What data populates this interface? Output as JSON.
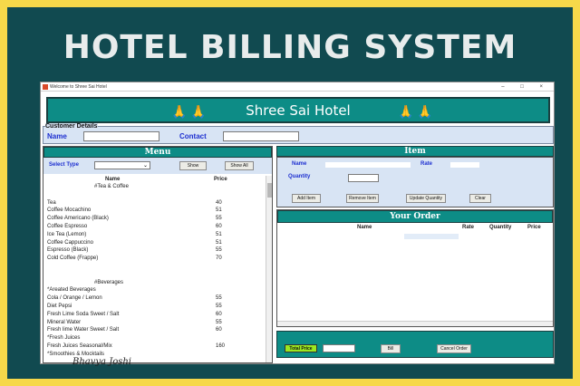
{
  "banner": "HOTEL BILLING SYSTEM",
  "window": {
    "title": "Welcome to Shree Sai Hotel",
    "controls": "–  □  ×"
  },
  "header": {
    "title": "Shree Sai Hotel",
    "hands": "🙏  🙏"
  },
  "customer": {
    "legend": "Customer Details",
    "name_label": "Name",
    "name_value": "",
    "contact_label": "Contact",
    "contact_value": ""
  },
  "menu": {
    "title": "Menu",
    "select_label": "Select Type",
    "select_value": "",
    "show_button": "Show",
    "show_all_button": "Show All",
    "col_name": "Name",
    "col_price": "Price",
    "rows": [
      {
        "name": "#Tea & Coffee",
        "price": "",
        "section": true
      },
      {
        "name": "",
        "price": ""
      },
      {
        "name": "Tea",
        "price": "40"
      },
      {
        "name": "Coffee Mocachino",
        "price": "51"
      },
      {
        "name": "Coffee Americano (Black)",
        "price": "55"
      },
      {
        "name": "Coffee Espresso",
        "price": "60"
      },
      {
        "name": "Ice Tea (Lemon)",
        "price": "51"
      },
      {
        "name": "Coffee Cappuccino",
        "price": "51"
      },
      {
        "name": "Espresso (Black)",
        "price": "55"
      },
      {
        "name": "Cold Coffee (Frappe)",
        "price": "70"
      },
      {
        "name": "",
        "price": ""
      },
      {
        "name": "",
        "price": ""
      },
      {
        "name": "#Beverages",
        "price": "",
        "section": true
      },
      {
        "name": "*Areated Beverages",
        "price": ""
      },
      {
        "name": "Cola / Orange / Lemon",
        "price": "55"
      },
      {
        "name": "Diet Pepsi",
        "price": "55"
      },
      {
        "name": "Fresh Lime Soda Sweet / Salt",
        "price": "60"
      },
      {
        "name": "Mineral Water",
        "price": "55"
      },
      {
        "name": "Fresh lime Water Sweet / Salt",
        "price": "60"
      },
      {
        "name": "*Fresh Juices",
        "price": ""
      },
      {
        "name": "Fresh Juices Seasonal/Mix",
        "price": "160"
      },
      {
        "name": "*Smoothies & Mocktails",
        "price": ""
      }
    ]
  },
  "item": {
    "title": "Item",
    "name_label": "Name",
    "rate_label": "Rate",
    "quantity_label": "Quantity",
    "add_button": "Add Item",
    "remove_button": "Remove Item",
    "update_button": "Update Quantity",
    "clear_button": "Clear"
  },
  "order": {
    "title": "Your Order",
    "col_name": "Name",
    "col_rate": "Rate",
    "col_quantity": "Quantity",
    "col_price": "Price"
  },
  "footer": {
    "total_label": "Total Price",
    "total_value": "",
    "bill_button": "Bill",
    "cancel_button": "Cancel Order"
  },
  "signature": "Bhavya Joshi"
}
